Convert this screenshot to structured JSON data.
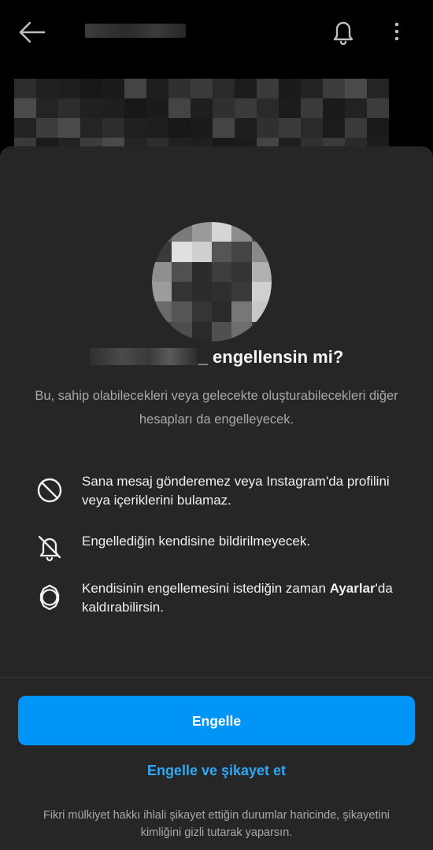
{
  "header": {
    "back_icon": "arrow-left-icon",
    "notification_icon": "bell-icon",
    "more_icon": "more-vertical-icon"
  },
  "dialog": {
    "title_suffix": "_ engellensin mi?",
    "subtitle": "Bu, sahip olabilecekleri veya gelecekte oluşturabilecekleri diğer hesapları da engelleyecek.",
    "info_items": [
      {
        "icon": "no-message-icon",
        "text": "Sana mesaj gönderemez veya Instagram'da profilini veya içeriklerini bulamaz."
      },
      {
        "icon": "bell-off-icon",
        "text": "Engellediğin kendisine bildirilmeyecek."
      },
      {
        "icon": "settings-icon",
        "text_before": "Kendisinin engellemesini istediğin zaman",
        "text_bold": "Ayarlar",
        "text_after": "'da kaldırabilirsin."
      }
    ],
    "block_button": "Engelle",
    "block_and_report_link": "Engelle ve şikayet et",
    "footer_note": "Fikri mülkiyet hakkı ihlali şikayet ettiğin durumlar haricinde, şikayetini kimliğini gizli tutarak yaparsın."
  },
  "colors": {
    "background": "#000000",
    "sheet": "#262626",
    "primary_button": "#0095f6",
    "link": "#2ea8f5",
    "secondary_text": "#a8a8a8"
  }
}
